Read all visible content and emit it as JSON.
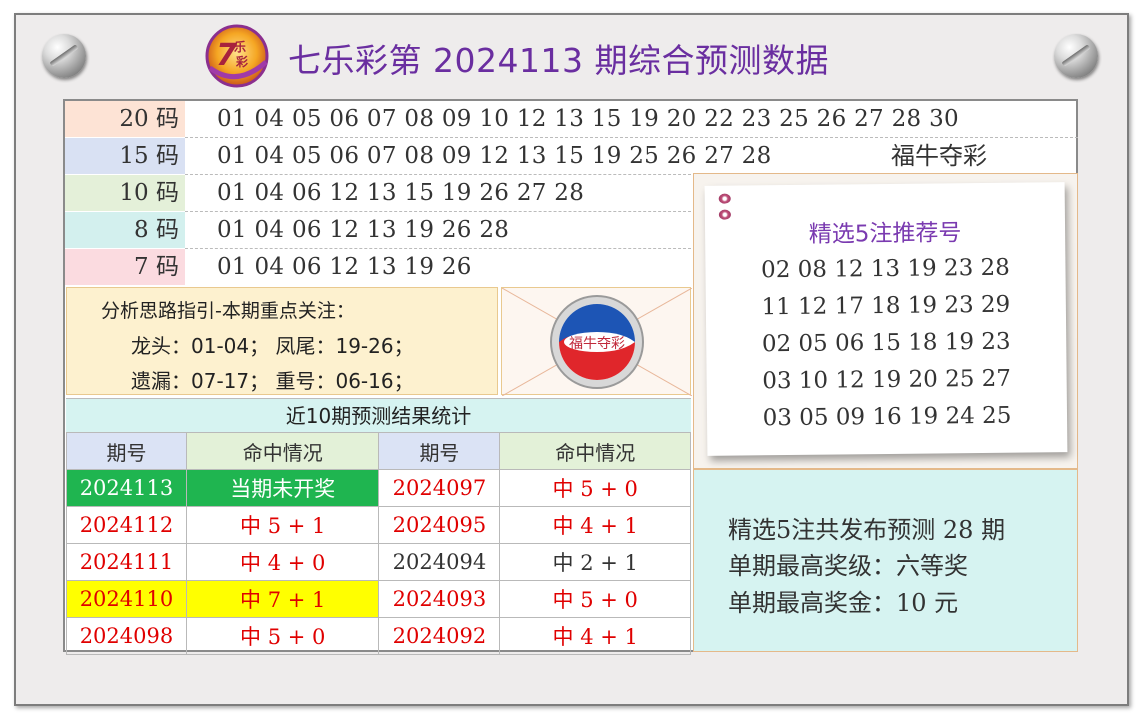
{
  "header": {
    "logo_text": "7乐彩",
    "title": "七乐彩第 2024113 期综合预测数据"
  },
  "numbers": [
    {
      "label": "20 码",
      "values": "01 04 05 06 07 08 09 10 12 13 15 19 20 22 23 25 26 27 28 30",
      "color": "#fde3d5"
    },
    {
      "label": "15 码",
      "values": "01 04 05 06 07 08 09 12 13 15 19 25 26 27 28",
      "color": "#d9e1f3"
    },
    {
      "label": "10 码",
      "values": "01 04 06 12 13 15 19 26 27 28",
      "color": "#e4f0d9"
    },
    {
      "label": "8 码",
      "values": "01 04 06 12 13 19 26 28",
      "color": "#d3f0ee"
    },
    {
      "label": "7 码",
      "values": "01 04 06 12 13 19 26",
      "color": "#fbdbe0"
    }
  ],
  "slogan": "福牛夺彩",
  "analysis": {
    "title": "分析思路指引-本期重点关注：",
    "line1": "龙头：01-04；  凤尾：19-26；",
    "line2": "遗漏：07-17；  重号：06-16；"
  },
  "emblem_text": "福牛夺彩",
  "recommend": {
    "title": "精选5注推荐号",
    "lines": [
      "02 08 12 13 19 23 28",
      "11 12 17 18 19 23 29",
      "02 05 06 15 18 19 23",
      "03 10 12 19 20 25 27",
      "03 05 09 16 19 24 25"
    ]
  },
  "stats": {
    "title": "近10期预测结果统计",
    "headers": [
      "期号",
      "命中情况",
      "期号",
      "命中情况"
    ],
    "rows": [
      [
        "2024113",
        "当期未开奖",
        "2024097",
        "中 5 + 0"
      ],
      [
        "2024112",
        "中 5 + 1",
        "2024095",
        "中 4 + 1"
      ],
      [
        "2024111",
        "中 4 + 0",
        "2024094",
        "中 2 + 1"
      ],
      [
        "2024110",
        "中 7 + 1",
        "2024093",
        "中 5 + 0"
      ],
      [
        "2024098",
        "中 5 + 0",
        "2024092",
        "中 4 + 1"
      ]
    ]
  },
  "summary": {
    "line1": "精选5注共发布预测 28 期",
    "line2": "单期最高奖级：六等奖",
    "line3": "单期最高奖金：10 元"
  }
}
